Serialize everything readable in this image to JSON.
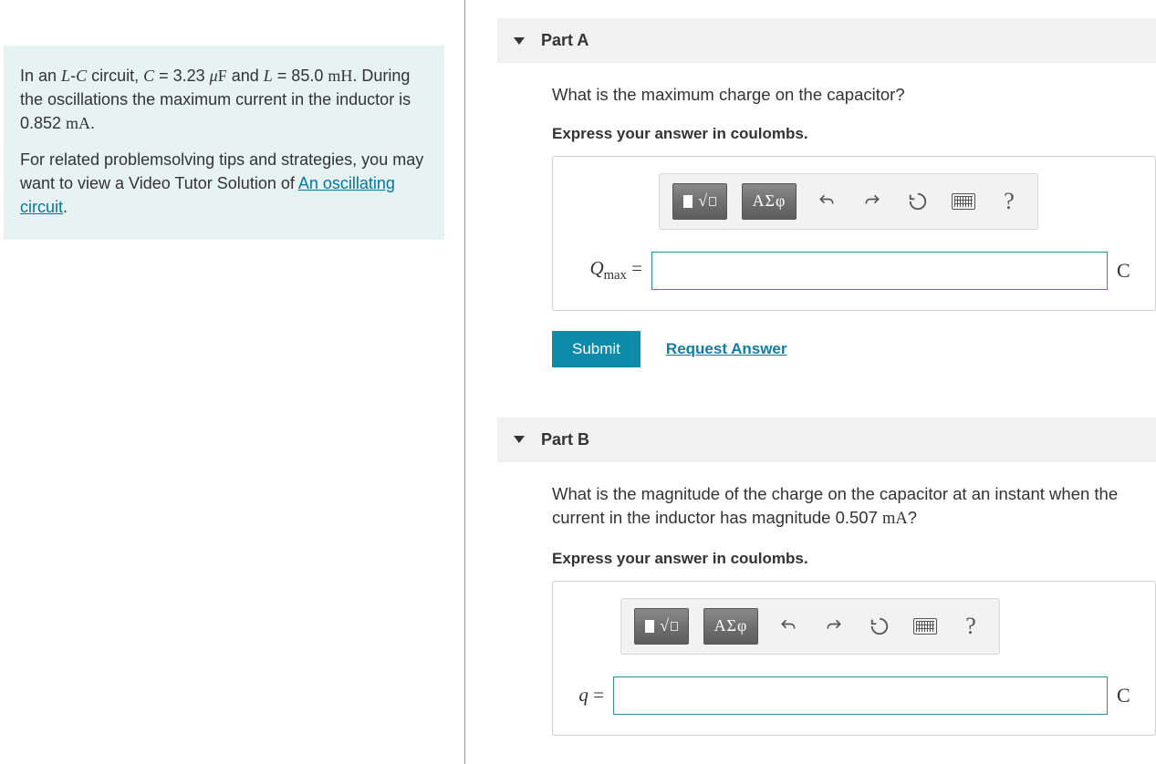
{
  "problem": {
    "intro_html": "In an <span class='math-var'>L</span>-<span class='math-var'>C</span> circuit, <span class='math-var'>C</span> = 3.23 <span class='math-var'>μ</span><span class='math-rm'>F</span> and <span class='math-var'>L</span> = 85.0 <span class='math-rm'>mH</span>. During the oscillations the maximum current in the inductor is 0.852 <span class='math-rm'>mA</span>.",
    "tips_prefix": "For related problemsolving tips and strategies, you may want to view a Video Tutor Solution of ",
    "tips_link": "An oscillating circuit",
    "tips_suffix": "."
  },
  "partA": {
    "title": "Part A",
    "question": "What is the maximum charge on the capacitor?",
    "instruction": "Express your answer in coulombs.",
    "var_label_html": "<span class='math-var'>Q</span><span class='sub'>max</span> =",
    "unit": "C",
    "submit": "Submit",
    "request": "Request Answer"
  },
  "partB": {
    "title": "Part B",
    "question_html": "What is the magnitude of the charge on the capacitor at an instant when the current in the inductor has magnitude 0.507 <span class='math-rm'>mA</span>?",
    "instruction": "Express your answer in coulombs.",
    "var_label_html": "<span class='math-var'>q</span> =",
    "unit": "C"
  },
  "toolbar": {
    "greek_label": "ΑΣφ",
    "undo": "↶",
    "redo": "↷",
    "reset": "↻",
    "help": "?"
  }
}
